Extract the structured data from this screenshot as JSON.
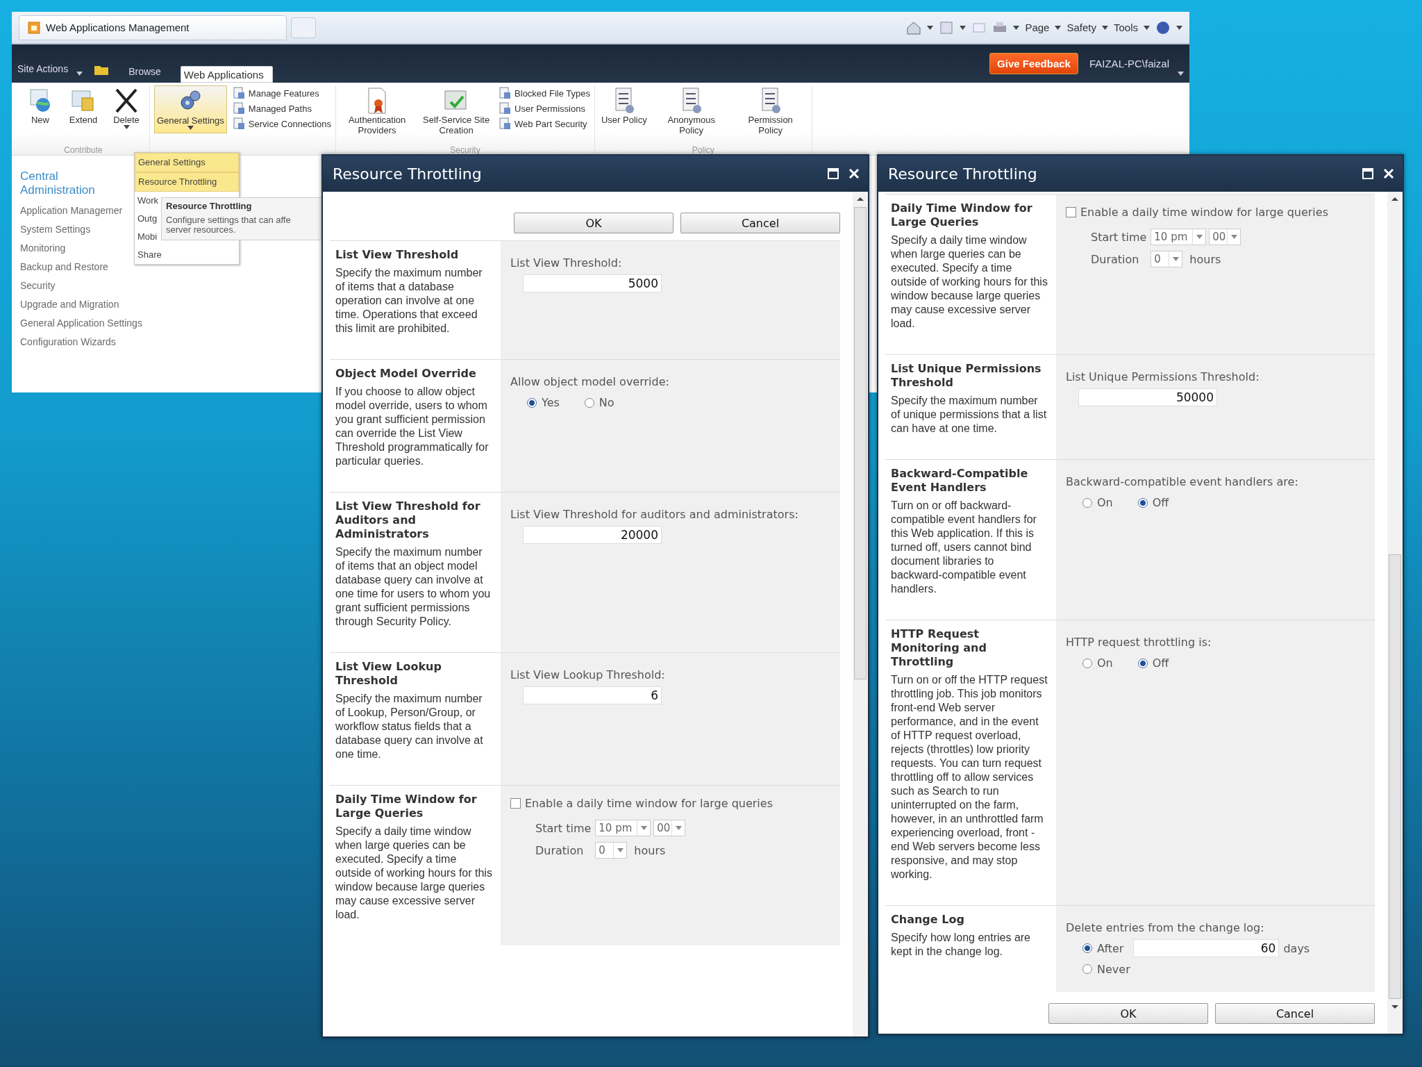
{
  "browser": {
    "tab_title": "Web Applications Management",
    "commands": [
      "Page",
      "Safety",
      "Tools"
    ]
  },
  "top_bar": {
    "site_actions": "Site Actions",
    "tabs": [
      {
        "label": "Browse",
        "selected": false
      },
      {
        "label": "Web Applications",
        "selected": true
      }
    ],
    "feedback": "Give Feedback",
    "user": "FAIZAL-PC\\faizal"
  },
  "ribbon": {
    "groups": [
      {
        "label": "Contribute",
        "items": [
          {
            "label": "New",
            "kind": "large"
          },
          {
            "label": "Extend",
            "kind": "large"
          },
          {
            "label": "Delete",
            "kind": "large",
            "menu": true
          }
        ]
      },
      {
        "items": [
          {
            "label": "General Settings",
            "kind": "large",
            "menu": true,
            "selected": true
          },
          {
            "kind": "stack",
            "items": [
              "Manage Features",
              "Managed Paths",
              "Service Connections"
            ]
          }
        ]
      },
      {
        "label": "Security",
        "items": [
          {
            "label": "Authentication Providers",
            "kind": "large"
          },
          {
            "label": "Self-Service Site Creation",
            "kind": "large"
          },
          {
            "kind": "stack",
            "items": [
              "Blocked File Types",
              "User Permissions",
              "Web Part Security"
            ]
          }
        ]
      },
      {
        "label": "Policy",
        "items": [
          {
            "label": "User Policy",
            "kind": "large"
          },
          {
            "label": "Anonymous Policy",
            "kind": "large"
          },
          {
            "label": "Permission Policy",
            "kind": "large"
          }
        ]
      }
    ]
  },
  "menu": {
    "items": [
      {
        "label": "General Settings",
        "highlighted": true
      },
      {
        "label": "Resource Throttling",
        "highlighted": true
      },
      {
        "label": "Work",
        "highlighted": false
      },
      {
        "label": "Outg",
        "highlighted": false
      },
      {
        "label": "Mobi",
        "highlighted": false
      },
      {
        "label": "Share",
        "highlighted": false
      }
    ]
  },
  "tooltip": {
    "title": "Resource Throttling",
    "lines": [
      "Configure settings that can affe",
      "server resources."
    ]
  },
  "left_nav": {
    "heading": "Central Administration",
    "items": [
      "Application Managemer",
      "System Settings",
      "Monitoring",
      "Backup and Restore",
      "Security",
      "Upgrade and Migration",
      "General Application Settings",
      "Configuration Wizards"
    ]
  },
  "dialogs": [
    {
      "title": "Resource Throttling",
      "content": [
        {
          "kind": "buttons",
          "buttons": [
            "OK",
            "Cancel"
          ]
        },
        {
          "kind": "number",
          "heading": "List View Threshold",
          "description": "Specify the maximum number of items that a database operation can involve at one time. Operations that exceed this limit are prohibited.",
          "label": "List View Threshold:",
          "value": "5000"
        },
        {
          "kind": "radio",
          "heading": "Object Model Override",
          "description": "If you choose to allow object model override, users to whom you grant sufficient permission can override the List View Threshold programmatically for particular queries.",
          "label": "Allow object model override:",
          "options": [
            {
              "label": "Yes",
              "selected": true
            },
            {
              "label": "No",
              "selected": false
            }
          ]
        },
        {
          "kind": "number",
          "heading": "List View Threshold for Auditors and Administrators",
          "description": "Specify the maximum number of items that an object model database query can involve at one time for users to whom you grant sufficient permissions through Security Policy.",
          "label": "List View Threshold for auditors and administrators:",
          "value": "20000"
        },
        {
          "kind": "number",
          "heading": "List View Lookup Threshold",
          "description": "Specify the maximum number of Lookup, Person/Group, or workflow status fields that a database query can involve at one time.",
          "label": "List View Lookup Threshold:",
          "value": "6"
        },
        {
          "kind": "time_window",
          "heading": "Daily Time Window for Large Queries",
          "description": "Specify a daily time window when large queries can be executed. Specify a time outside of working hours for this window because large queries may cause excessive server load.",
          "checkbox": {
            "label": "Enable a daily time window for large queries",
            "checked": false
          },
          "start_label": "Start time",
          "hour": "10 pm",
          "minute": "00",
          "duration_label": "Duration",
          "duration": "0",
          "unit": "hours"
        }
      ]
    },
    {
      "title": "Resource Throttling",
      "content": [
        {
          "kind": "time_window",
          "heading": "Daily Time Window for Large Queries",
          "description": "Specify a daily time window when large queries can be executed. Specify a time outside of working hours for this window because large queries may cause excessive server load.",
          "checkbox": {
            "label": "Enable a daily time window for large queries",
            "checked": false
          },
          "start_label": "Start time",
          "hour": "10 pm",
          "minute": "00",
          "duration_label": "Duration",
          "duration": "0",
          "unit": "hours"
        },
        {
          "kind": "number",
          "heading": "List Unique Permissions Threshold",
          "description": "Specify the maximum number of unique permissions that a list can have at one time.",
          "label": "List Unique Permissions Threshold:",
          "value": "50000"
        },
        {
          "kind": "radio",
          "heading": "Backward-Compatible Event Handlers",
          "description": "Turn on or off backward-compatible event handlers for this Web application. If this is turned off, users cannot bind document libraries to backward-compatible event handlers.",
          "label": "Backward-compatible event handlers are:",
          "options": [
            {
              "label": "On",
              "selected": false
            },
            {
              "label": "Off",
              "selected": true
            }
          ]
        },
        {
          "kind": "radio",
          "heading": "HTTP Request Monitoring and Throttling",
          "description": "Turn on or off the HTTP request throttling job. This job monitors front-end Web server performance, and in the event of HTTP request overload, rejects (throttles) low priority requests. You can turn request throttling off to allow services such as Search to run uninterrupted on the farm, however, in an unthrottled farm experiencing overload, front -end Web servers become less responsive, and may stop working.",
          "label": "HTTP request throttling is:",
          "options": [
            {
              "label": "On",
              "selected": false
            },
            {
              "label": "Off",
              "selected": true
            }
          ]
        },
        {
          "kind": "retention",
          "heading": "Change Log",
          "description": "Specify how long entries are kept in the change log.",
          "label": "Delete entries from the change log:",
          "options": [
            {
              "label": "After",
              "selected": true,
              "value": "60",
              "unit": "days"
            },
            {
              "label": "Never",
              "selected": false
            }
          ]
        },
        {
          "kind": "buttons",
          "buttons": [
            "OK",
            "Cancel"
          ]
        }
      ]
    }
  ]
}
